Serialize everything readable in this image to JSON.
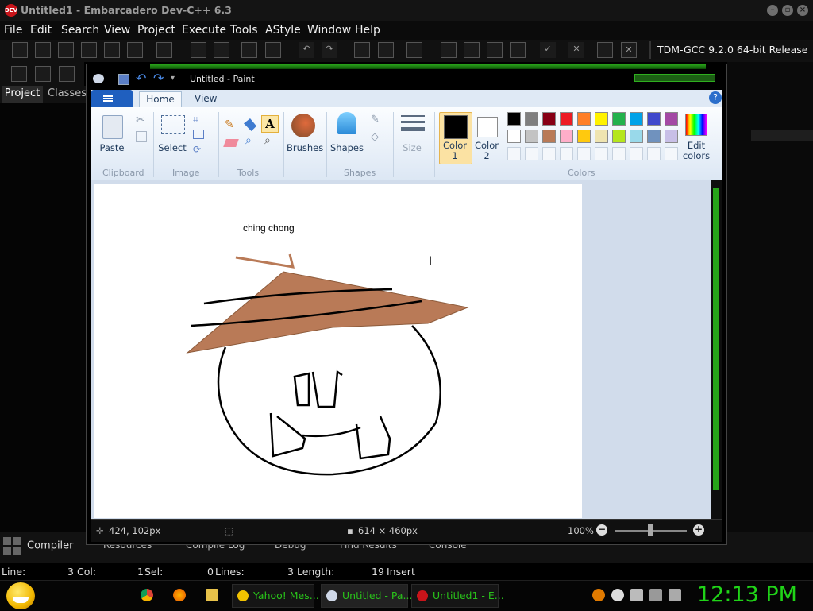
{
  "dev": {
    "title": "Untitled1 - Embarcadero Dev-C++ 6.3",
    "app_icon_text": "DEV C++",
    "menu": [
      "File",
      "Edit",
      "Search",
      "View",
      "Project",
      "Execute",
      "Tools",
      "AStyle",
      "Window",
      "Help"
    ],
    "compiler": "TDM-GCC 9.2.0 64-bit Release",
    "left_tabs": [
      "Project",
      "Classes"
    ],
    "bottom_tabs": [
      "Compiler",
      "Resources",
      "Compile Log",
      "Debug",
      "Find Results",
      "Console"
    ],
    "status": {
      "line_label": "Line:",
      "line_value": "3",
      "col_label": "Col:",
      "col_value": "1",
      "sel_label": "Sel:",
      "sel_value": "0",
      "lines_label": "Lines:",
      "lines_value": "3",
      "length_label": "Length:",
      "length_value": "19",
      "mode": "Insert"
    }
  },
  "paint": {
    "title": "Untitled - Paint",
    "tabs": [
      "Home",
      "View"
    ],
    "groups": {
      "clipboard": "Clipboard",
      "image": "Image",
      "tools": "Tools",
      "shapes": "Shapes",
      "colors": "Colors"
    },
    "buttons": {
      "paste": "Paste",
      "select": "Select",
      "brushes": "Brushes",
      "shapes": "Shapes",
      "size": "Size",
      "color1": "Color 1",
      "color2": "Color 2",
      "edit_colors": "Edit colors"
    },
    "text_tool_glyph": "A",
    "canvas_text": "ching chong",
    "status": {
      "cursor_pos": "424, 102px",
      "canvas_size": "614 × 460px",
      "zoom": "100%"
    },
    "palette_row1": [
      "#000000",
      "#7f7f7f",
      "#880015",
      "#ed1c24",
      "#ff7f27",
      "#fff200",
      "#22b14c",
      "#00a2e8",
      "#3f48cc",
      "#a349a4"
    ],
    "palette_row2": [
      "#ffffff",
      "#c3c3c3",
      "#b97a57",
      "#ffaec9",
      "#ffc90e",
      "#efe4b0",
      "#b5e61d",
      "#99d9ea",
      "#7092be",
      "#c8bfe7"
    ],
    "hat_color": "#b97a57"
  },
  "taskbar": {
    "items": [
      "Yahoo! Mes...",
      "Untitled - Pa...",
      "Untitled1 - E..."
    ],
    "clock": "12:13 PM"
  }
}
